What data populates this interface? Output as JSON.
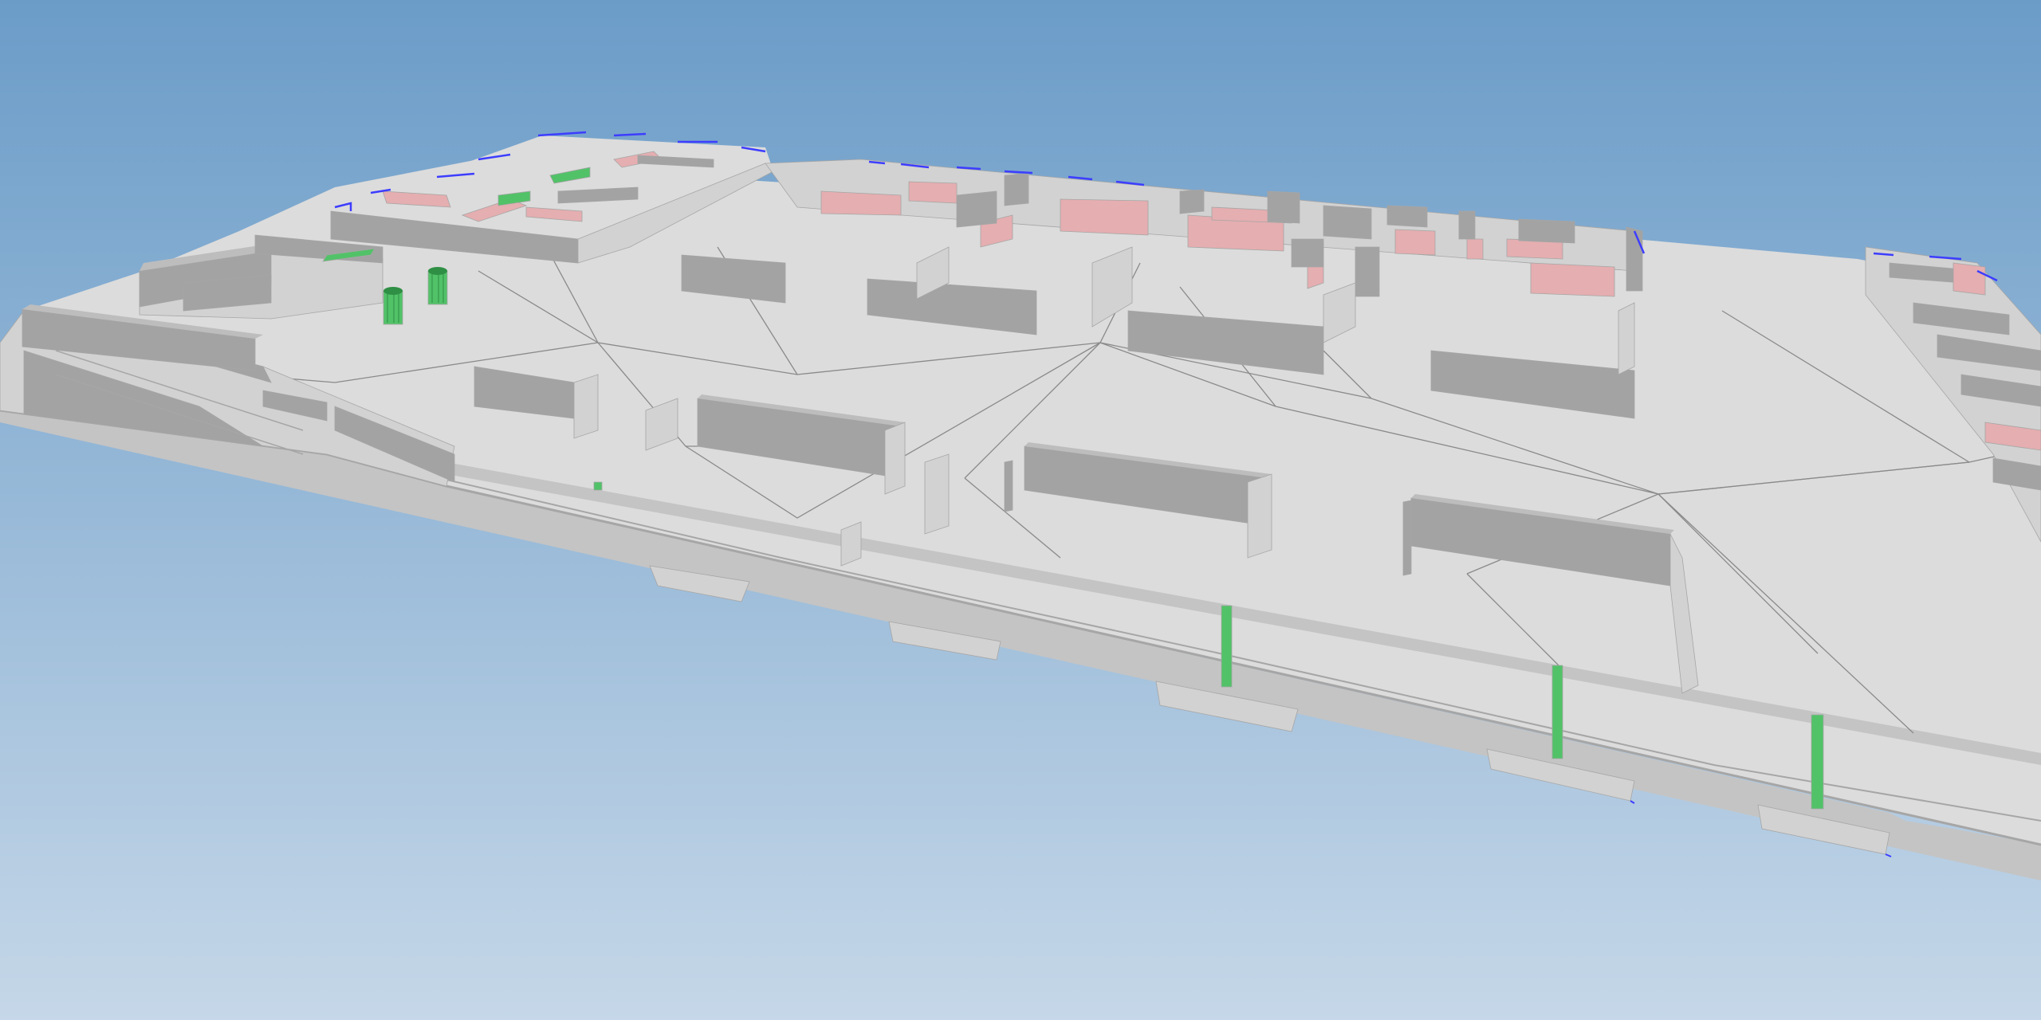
{
  "viewer": {
    "kind": "3d-model-viewport",
    "visible_text": []
  },
  "colors": {
    "sky_top": "#6b9cc8",
    "sky_bottom": "#c5d7e8",
    "slab_top": "#dcdcdc",
    "slab_side": "#c4c4c4",
    "slab_edge": "#a6a6a6",
    "wall_face": "#a3a3a3",
    "wall_light": "#d2d2d2",
    "wall_top": "#bdbdbd",
    "pink_wall": "#e5aeb0",
    "green_element": "#52c268",
    "green_dark": "#2f8f44",
    "blue_edge": "#3d3dff",
    "triangulation_line": "#8a8a8a"
  }
}
